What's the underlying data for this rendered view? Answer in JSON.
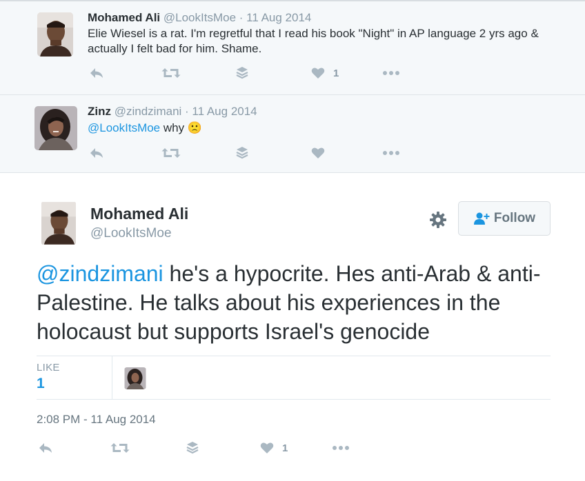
{
  "conversation": [
    {
      "name": "Mohamed Ali",
      "meta": "@LookItsMoe · 11 Aug 2014",
      "text": "Elie Wiesel is a rat. I'm regretful that I read his book \"Night\" in AP language 2 yrs ago & actually I felt bad for him. Shame.",
      "like_count": "1",
      "avatar_icon": "profile-photo-man"
    },
    {
      "name": "Zinz",
      "meta": "@zindzimani · 11 Aug 2014",
      "mention": "@LookItsMoe",
      "text": "why",
      "emoji": "🙁",
      "like_count": "",
      "avatar_icon": "profile-photo-woman"
    }
  ],
  "main_tweet": {
    "name": "Mohamed Ali",
    "handle": "@LookItsMoe",
    "follow_label": "Follow",
    "mention": "@zindzimani",
    "text": " he's a hypocrite. Hes anti-Arab & anti-Palestine. He talks about his experiences in the holocaust but supports Israel's genocide",
    "likes_label": "LIKE",
    "likes_count": "1",
    "timestamp": "2:08 PM - 11 Aug 2014",
    "like_count": "1"
  },
  "colors": {
    "link": "#1b95e0",
    "icon": "#aab8c2",
    "muted": "#8899a6",
    "text": "#292f33",
    "conversation_bg": "#f5f8fa"
  },
  "icons": [
    "reply-icon",
    "retweet-icon",
    "stack-icon",
    "heart-icon",
    "more-icon",
    "gear-icon",
    "follow-person-icon"
  ]
}
